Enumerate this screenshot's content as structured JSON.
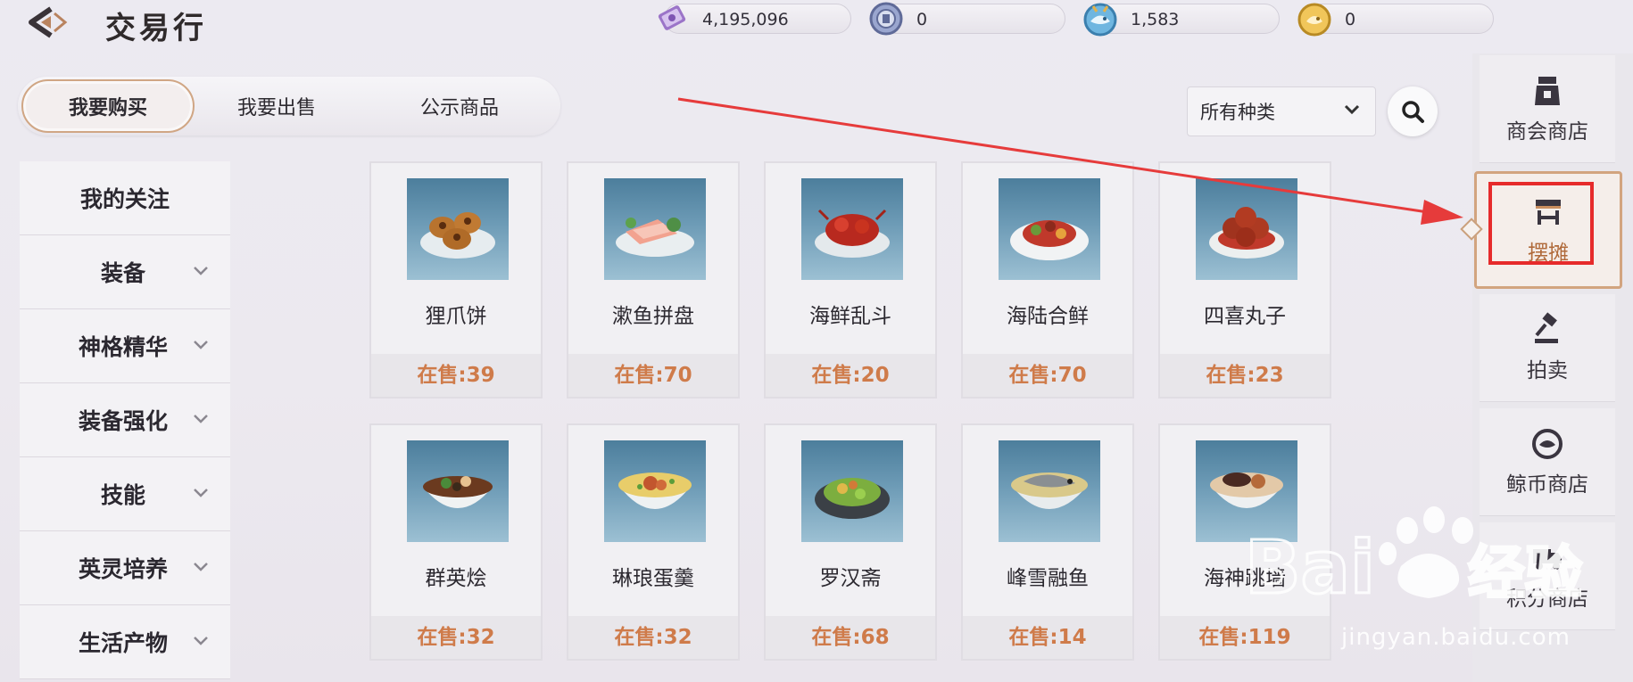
{
  "header": {
    "title": "交易行"
  },
  "currencies": [
    {
      "value": "4,195,096",
      "icon": "crystal-ticket-icon",
      "color": "#b48fd6"
    },
    {
      "value": "0",
      "icon": "coin-token-icon",
      "color": "#8b9cc9"
    },
    {
      "value": "1,583",
      "icon": "whale-coin-icon",
      "color": "#5aa9d8"
    },
    {
      "value": "0",
      "icon": "gold-coin-icon",
      "color": "#e6b64a"
    }
  ],
  "tabs": [
    {
      "label": "我要购买",
      "active": true
    },
    {
      "label": "我要出售",
      "active": false
    },
    {
      "label": "公示商品",
      "active": false
    }
  ],
  "filter": {
    "selected": "所有种类"
  },
  "menu": [
    {
      "label": "我的关注",
      "expandable": false
    },
    {
      "label": "装备",
      "expandable": true
    },
    {
      "label": "神格精华",
      "expandable": true
    },
    {
      "label": "装备强化",
      "expandable": true
    },
    {
      "label": "技能",
      "expandable": true
    },
    {
      "label": "英灵培养",
      "expandable": true
    },
    {
      "label": "生活产物",
      "expandable": true
    }
  ],
  "items": [
    {
      "name": "狸爪饼",
      "stock": "在售:39"
    },
    {
      "name": "漱鱼拼盘",
      "stock": "在售:70"
    },
    {
      "name": "海鲜乱斗",
      "stock": "在售:20"
    },
    {
      "name": "海陆合鲜",
      "stock": "在售:70"
    },
    {
      "name": "四喜丸子",
      "stock": "在售:23"
    },
    {
      "name": "群英烩",
      "stock": "在售:32"
    },
    {
      "name": "琳琅蛋羹",
      "stock": "在售:32"
    },
    {
      "name": "罗汉斋",
      "stock": "在售:68"
    },
    {
      "name": "峰雪融鱼",
      "stock": "在售:14"
    },
    {
      "name": "海神跳墙",
      "stock": "在售:119"
    }
  ],
  "sidebar": [
    {
      "label": "商会商店",
      "icon": "merchant-bag-icon"
    },
    {
      "label": "摆摊",
      "icon": "stall-icon",
      "active": true
    },
    {
      "label": "拍卖",
      "icon": "gavel-icon"
    },
    {
      "label": "鲸币商店",
      "icon": "whale-coin-icon"
    },
    {
      "label": "积分商店",
      "icon": "truck-icon"
    }
  ],
  "annotation": {
    "arrow_color": "#e63b3b",
    "highlight_color": "#e62b2b"
  },
  "watermark": {
    "brand": "Bai du 经验",
    "url": "jingyan.baidu.com"
  }
}
